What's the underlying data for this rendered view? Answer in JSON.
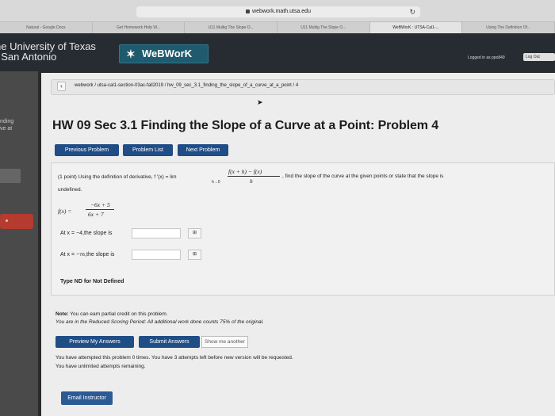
{
  "browser": {
    "url": "webwork.math.utsa.edu",
    "tabs": [
      "Natural - Google Docs",
      "Get Homework Help W...",
      "U11 Multig The Slope O...",
      "U11 Multig The Slope O...",
      "WeBWorK : UTSA-Cal1-...",
      "Using The Definition Of..."
    ],
    "active_tab": 4
  },
  "header": {
    "university_line1": "he University of Texas",
    "university_line2": "t San Antonio",
    "brand": "WeBWorK",
    "logged_in": "Logged in as ppo849",
    "logout": "Log Out"
  },
  "sidebar": {
    "text1": "nding",
    "text2": "ve at"
  },
  "breadcrumb": {
    "path": "webwork / utsa-cal1-section-03ac-fall2019 / hw_09_sec_3.1_finding_the_slope_of_a_curve_at_a_point / 4"
  },
  "page": {
    "title": "HW 09 Sec 3.1 Finding the Slope of a Curve at a Point: Problem 4"
  },
  "nav": {
    "previous": "Previous Problem",
    "list": "Problem List",
    "next": "Next Problem"
  },
  "problem": {
    "intro": "(1 point) Using the definition of derivative, f ′(x) = lim",
    "lim_sub": "h→0",
    "frac_num": "f(x + h) − f(x)",
    "frac_den": "h",
    "after": ", find the slope of the curve at the given points or state that the slope is",
    "undefined": "undefined.",
    "f_label": "f(x) =",
    "f_num": "−6x + 5",
    "f_den": "6x + 7",
    "q1": "At x = −4,the slope is",
    "q2_pre": "At x = −",
    "q2_frac": "7/6",
    "q2_post": ",the slope is",
    "matrix_icon": "⊞",
    "type_nd": "Type ND for Not Defined"
  },
  "notes": {
    "note_label": "Note:",
    "note1": " You can earn partial credit on this problem.",
    "note2": "You are in the Reduced Scoring Period: All additional work done counts 75% of the original."
  },
  "actions": {
    "preview": "Preview My Answers",
    "submit": "Submit Answers",
    "show_another": "Show me another"
  },
  "attempts": {
    "line1": "You have attempted this problem 0 times. You have 3 attempts left before new version will be requested.",
    "line2": "You have unlimited attempts remaining."
  },
  "footer": {
    "email": "Email Instructor"
  }
}
